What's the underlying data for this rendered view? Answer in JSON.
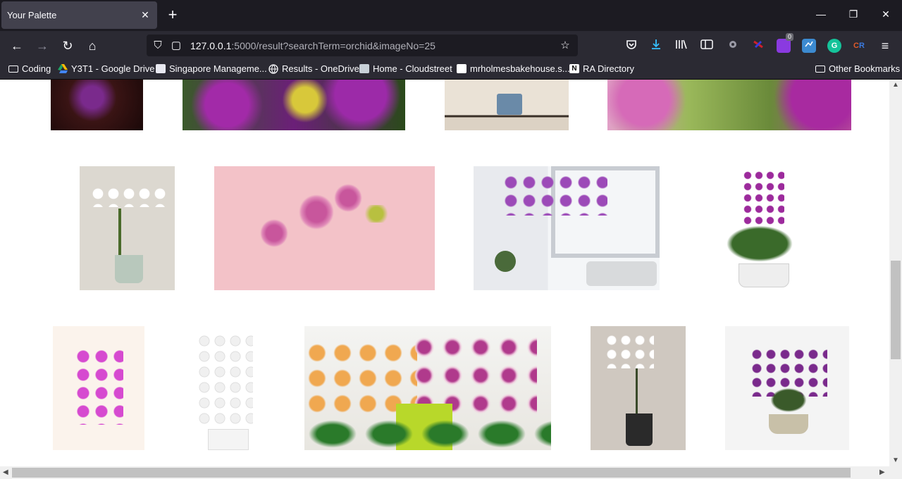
{
  "tab": {
    "title": "Your Palette",
    "close": "✕",
    "new": "+"
  },
  "window": {
    "minimize": "—",
    "restore": "❐",
    "close": "✕"
  },
  "nav": {
    "back": "←",
    "forward": "→",
    "reload": "↻",
    "home": "⌂",
    "url_host": "127.0.0.1",
    "url_rest": ":5000/result?searchTerm=orchid&imageNo=25",
    "shield": "⛉",
    "page": "▢",
    "star": "☆"
  },
  "extensions": {
    "badge_count": "0",
    "menu": "≡"
  },
  "bookmarks": [
    {
      "label": "Coding",
      "icon": "folder-icon"
    },
    {
      "label": "Y3T1 - Google Drive",
      "icon": "google-drive-icon"
    },
    {
      "label": "Singapore Manageme...",
      "icon": "smu-icon"
    },
    {
      "label": "Results - OneDrive",
      "icon": "globe-icon"
    },
    {
      "label": "Home - Cloudstreet",
      "icon": "cloudstreet-icon"
    },
    {
      "label": "mrholmesbakehouse.s...",
      "icon": "bakehouse-icon"
    },
    {
      "label": "RA Directory",
      "icon": "notion-icon"
    }
  ],
  "other_bookmarks": "Other Bookmarks",
  "gallery": {
    "rows": [
      [
        {
          "name": "orchid-dark-purple",
          "colors": [
            "#2a0f0f",
            "#7a2a8c"
          ]
        },
        {
          "name": "orchid-purple-yellow-garden",
          "colors": [
            "#6b1f78",
            "#d8c030"
          ]
        },
        {
          "name": "orchid-potted-shelf",
          "colors": [
            "#e8ddd0",
            "#4a6c8c"
          ]
        },
        {
          "name": "orchid-pink-garden",
          "colors": [
            "#d36bb0",
            "#7aa040"
          ]
        }
      ],
      [
        {
          "name": "white-orchid-sage-pot",
          "colors": [
            "#d8d4cc",
            "#b8c8bc"
          ]
        },
        {
          "name": "pink-orchid-branch",
          "colors": [
            "#f4c2c8",
            "#c8569c"
          ]
        },
        {
          "name": "purple-orchid-window",
          "colors": [
            "#e6e8ec",
            "#9c4ab8"
          ]
        },
        {
          "name": "purple-orchid-bonsai",
          "colors": [
            "#ffffff",
            "#9c2a9c"
          ]
        }
      ],
      [
        {
          "name": "magenta-orchid-stem",
          "colors": [
            "#fbf3ec",
            "#d64ad0"
          ]
        },
        {
          "name": "white-orchid-artificial",
          "colors": [
            "#ffffff",
            "#e8e8e8"
          ]
        },
        {
          "name": "orange-spotted-orchids",
          "colors": [
            "#f0b050",
            "#b03a8c"
          ]
        },
        {
          "name": "white-orchid-black-pot",
          "colors": [
            "#cfc8c0",
            "#2a2a2a"
          ]
        },
        {
          "name": "purple-orchid-ceramic",
          "colors": [
            "#f4f4f4",
            "#7a2a8c"
          ]
        }
      ]
    ]
  }
}
